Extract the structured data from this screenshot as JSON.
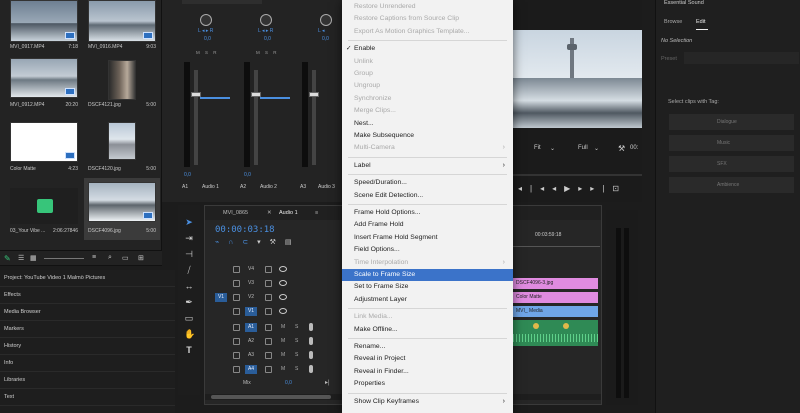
{
  "project_bin": {
    "items": [
      {
        "name": "MVI_0917.MP4",
        "duration": "7:18"
      },
      {
        "name": "MVI_0916.MP4",
        "duration": "9:03"
      },
      {
        "name": "MVI_0912.MP4",
        "duration": "20:20"
      },
      {
        "name": "DSCF4121.jpg",
        "duration": "5:00"
      },
      {
        "name": "Color Matte",
        "duration": "4:23"
      },
      {
        "name": "DSCF4120.jpg",
        "duration": "5:00"
      },
      {
        "name": "03_Your Vibe ...",
        "duration": "2:06:27846"
      },
      {
        "name": "DSCF4096.jpg",
        "duration": "5:00"
      }
    ],
    "project_label": "Project: YouTube Video 1 Malmö Pictures"
  },
  "side_panels": [
    "Effects",
    "Media Browser",
    "Markers",
    "History",
    "Info",
    "Libraries",
    "Text"
  ],
  "mixer": {
    "channels": [
      {
        "id": "A1",
        "name": "Audio 1",
        "value": "0,0"
      },
      {
        "id": "A2",
        "name": "Audio 2",
        "value": "0,0"
      },
      {
        "id": "A3",
        "name": "Audio 3",
        "value": "0,0"
      }
    ],
    "pan_label": "L",
    "pan_label_r": "R",
    "msr": "M S R"
  },
  "timeline": {
    "tabs": [
      "MVI_0865",
      "Audio 1"
    ],
    "timecode": "00:00:03:18",
    "ruler_time": "00:03:59:18",
    "tracks": [
      {
        "label": "V4",
        "type": "video"
      },
      {
        "label": "V3",
        "type": "video"
      },
      {
        "label": "V2",
        "type": "video"
      },
      {
        "label": "V1",
        "type": "video",
        "source": "V1"
      },
      {
        "label": "A1",
        "type": "audio",
        "source": "A1"
      },
      {
        "label": "A2",
        "type": "audio"
      },
      {
        "label": "A3",
        "type": "audio"
      },
      {
        "label": "A4",
        "type": "audio"
      }
    ],
    "mix_label": "Mix",
    "mix_value": "0,0",
    "clips": [
      {
        "label": "DSCF4096-3.jpg",
        "color": "#e08be0"
      },
      {
        "label": "Color Matte",
        "color": "#e08be0"
      },
      {
        "label": "MVI_ Media",
        "color": "#6fa6e8"
      }
    ],
    "ms_m": "M",
    "ms_s": "S"
  },
  "program": {
    "fit": "Fit",
    "full": "Full",
    "time": "00:"
  },
  "essential_sound": {
    "title": "Essential Sound",
    "tabs": [
      "Browse",
      "Edit"
    ],
    "no_selection": "No Selection",
    "preset": "Preset",
    "select_label": "Select clips with Tag:",
    "buttons": [
      "Dialogue",
      "Music",
      "SFX",
      "Ambience"
    ]
  },
  "context_menu": {
    "items": [
      {
        "label": "Restore Unrendered",
        "disabled": true
      },
      {
        "label": "Restore Captions from Source Clip",
        "disabled": true
      },
      {
        "label": "Export As Motion Graphics Template...",
        "disabled": true
      },
      {
        "sep": true
      },
      {
        "label": "Enable",
        "checked": true
      },
      {
        "label": "Unlink",
        "disabled": true
      },
      {
        "label": "Group",
        "disabled": true
      },
      {
        "label": "Ungroup",
        "disabled": true
      },
      {
        "label": "Synchronize",
        "disabled": true
      },
      {
        "label": "Merge Clips...",
        "disabled": true
      },
      {
        "label": "Nest..."
      },
      {
        "label": "Make Subsequence"
      },
      {
        "label": "Multi-Camera",
        "disabled": true,
        "submenu": true
      },
      {
        "sep": true
      },
      {
        "label": "Label",
        "submenu": true
      },
      {
        "sep": true
      },
      {
        "label": "Speed/Duration..."
      },
      {
        "label": "Scene Edit Detection..."
      },
      {
        "sep": true
      },
      {
        "label": "Frame Hold Options..."
      },
      {
        "label": "Add Frame Hold"
      },
      {
        "label": "Insert Frame Hold Segment"
      },
      {
        "label": "Field Options..."
      },
      {
        "label": "Time Interpolation",
        "disabled": true,
        "submenu": true
      },
      {
        "label": "Scale to Frame Size",
        "highlighted": true
      },
      {
        "label": "Set to Frame Size"
      },
      {
        "label": "Adjustment Layer"
      },
      {
        "sep": true
      },
      {
        "label": "Link Media...",
        "disabled": true
      },
      {
        "label": "Make Offline..."
      },
      {
        "sep": true
      },
      {
        "label": "Rename..."
      },
      {
        "label": "Reveal in Project"
      },
      {
        "label": "Reveal in Finder..."
      },
      {
        "label": "Properties"
      },
      {
        "sep": true
      },
      {
        "label": "Show Clip Keyframes",
        "submenu": true
      }
    ]
  }
}
